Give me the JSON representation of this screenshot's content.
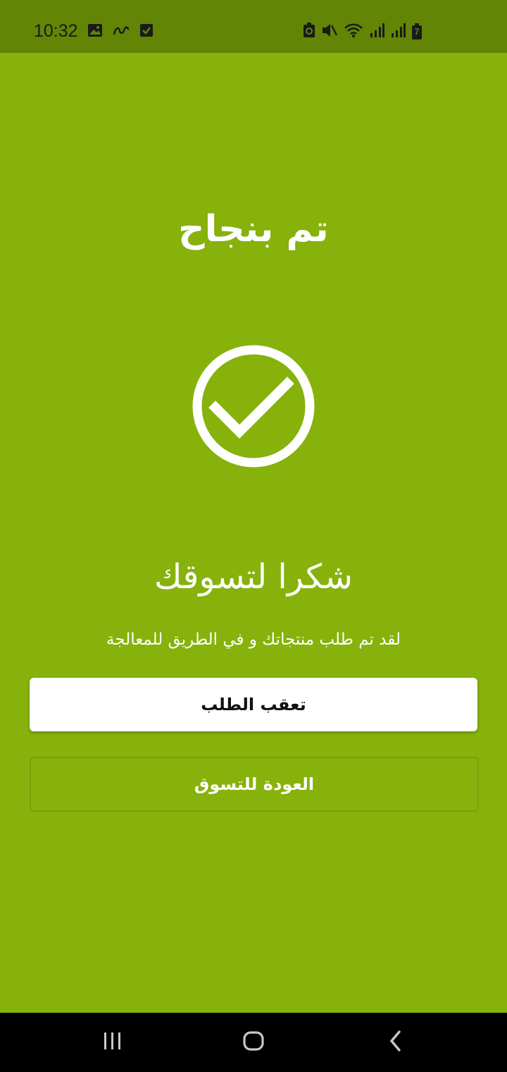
{
  "status_bar": {
    "time": "10:32",
    "left_icons": [
      "image-icon",
      "link-icon",
      "checkbox-icon"
    ],
    "right_icons": [
      "recycle-icon",
      "mute-icon",
      "wifi-icon",
      "signal-icon",
      "signal-icon",
      "battery-icon"
    ],
    "battery_level": "7",
    "background": "#628505"
  },
  "main": {
    "background": "#86b20b",
    "title": "تم بنجاح",
    "success_icon": "check-circle-icon",
    "heading": "شكرا لتسوقك",
    "message": "لقد تم طلب منتجاتك و في الطريق للمعالجة"
  },
  "buttons": {
    "track_order": "تعقب الطلب",
    "back_to_shopping": "العودة للتسوق"
  },
  "nav_bar": {
    "items": [
      "recent-apps-icon",
      "home-icon",
      "back-icon"
    ]
  }
}
